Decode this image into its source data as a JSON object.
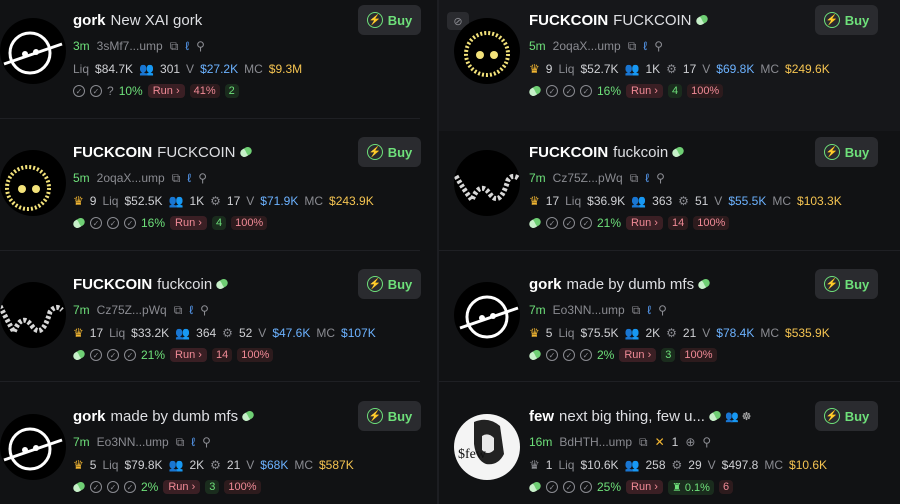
{
  "cards": [
    {
      "ticker": "gork",
      "name": "New XAI gork",
      "age": "3m",
      "address": "3sMf7...ump",
      "liq_label": "Liq",
      "liq": "$84.7K",
      "holders_count": "301",
      "vol_label": "V",
      "vol": "$27.2K",
      "mc_label": "MC",
      "mc": "$9.3M",
      "q_mark": "?",
      "holders_pct": "10%",
      "run_label": "Run",
      "dev_pct": "41%",
      "views": "2",
      "buy_label": "Buy"
    },
    {
      "ticker": "FUCKCOIN",
      "name": "FUCKCOIN",
      "age": "5m",
      "address": "2oqaX...ump",
      "crown_count": "9",
      "liq_label": "Liq",
      "liq": "$52.7K",
      "holders_count": "1K",
      "bots": "17",
      "vol_label": "V",
      "vol": "$69.8K",
      "mc_label": "MC",
      "mc": "$249.6K",
      "holders_pct": "16%",
      "run_label": "Run",
      "views": "4",
      "runners": "100%",
      "buy_label": "Buy"
    },
    {
      "ticker": "FUCKCOIN",
      "name": "FUCKCOIN",
      "age": "5m",
      "address": "2oqaX...ump",
      "crown_count": "9",
      "liq_label": "Liq",
      "liq": "$52.5K",
      "holders_count": "1K",
      "bots": "17",
      "vol_label": "V",
      "vol": "$71.9K",
      "mc_label": "MC",
      "mc": "$243.9K",
      "holders_pct": "16%",
      "run_label": "Run",
      "views": "4",
      "runners": "100%",
      "buy_label": "Buy"
    },
    {
      "ticker": "FUCKCOIN",
      "name": "fuckcoin",
      "age": "7m",
      "address": "Cz75Z...pWq",
      "crown_count": "17",
      "liq_label": "Liq",
      "liq": "$36.9K",
      "holders_count": "363",
      "bots": "51",
      "vol_label": "V",
      "vol": "$55.5K",
      "mc_label": "MC",
      "mc": "$103.3K",
      "holders_pct": "21%",
      "run_label": "Run",
      "views": "14",
      "runners": "100%",
      "buy_label": "Buy"
    },
    {
      "ticker": "FUCKCOIN",
      "name": "fuckcoin",
      "age": "7m",
      "address": "Cz75Z...pWq",
      "crown_count": "17",
      "liq_label": "Liq",
      "liq": "$33.2K",
      "holders_count": "364",
      "bots": "52",
      "vol_label": "V",
      "vol": "$47.6K",
      "mc_label": "MC",
      "mc": "$107K",
      "holders_pct": "21%",
      "run_label": "Run",
      "views": "14",
      "runners": "100%",
      "buy_label": "Buy"
    },
    {
      "ticker": "gork",
      "name": "made by dumb mfs",
      "age": "7m",
      "address": "Eo3NN...ump",
      "crown_count": "5",
      "liq_label": "Liq",
      "liq": "$75.5K",
      "holders_count": "2K",
      "bots": "21",
      "vol_label": "V",
      "vol": "$78.4K",
      "mc_label": "MC",
      "mc": "$535.9K",
      "holders_pct": "2%",
      "run_label": "Run",
      "views": "3",
      "runners": "100%",
      "buy_label": "Buy"
    },
    {
      "ticker": "gork",
      "name": "made by dumb mfs",
      "age": "7m",
      "address": "Eo3NN...ump",
      "crown_count": "5",
      "liq_label": "Liq",
      "liq": "$79.8K",
      "holders_count": "2K",
      "bots": "21",
      "vol_label": "V",
      "vol": "$68K",
      "mc_label": "MC",
      "mc": "$587K",
      "holders_pct": "2%",
      "run_label": "Run",
      "views": "3",
      "runners": "100%",
      "buy_label": "Buy"
    },
    {
      "ticker": "few",
      "name": "next big thing, few u...",
      "age": "16m",
      "address": "BdHTH...ump",
      "x_count": "1",
      "crown_count": "1",
      "liq_label": "Liq",
      "liq": "$10.6K",
      "holders_count": "258",
      "bots": "29",
      "vol_label": "V",
      "vol": "$497.8",
      "mc_label": "MC",
      "mc": "$10.6K",
      "holders_pct": "25%",
      "run_label": "Run",
      "dev_pct": "0.1%",
      "flags": "6",
      "buy_label": "Buy",
      "avatar_text": "$few"
    }
  ]
}
